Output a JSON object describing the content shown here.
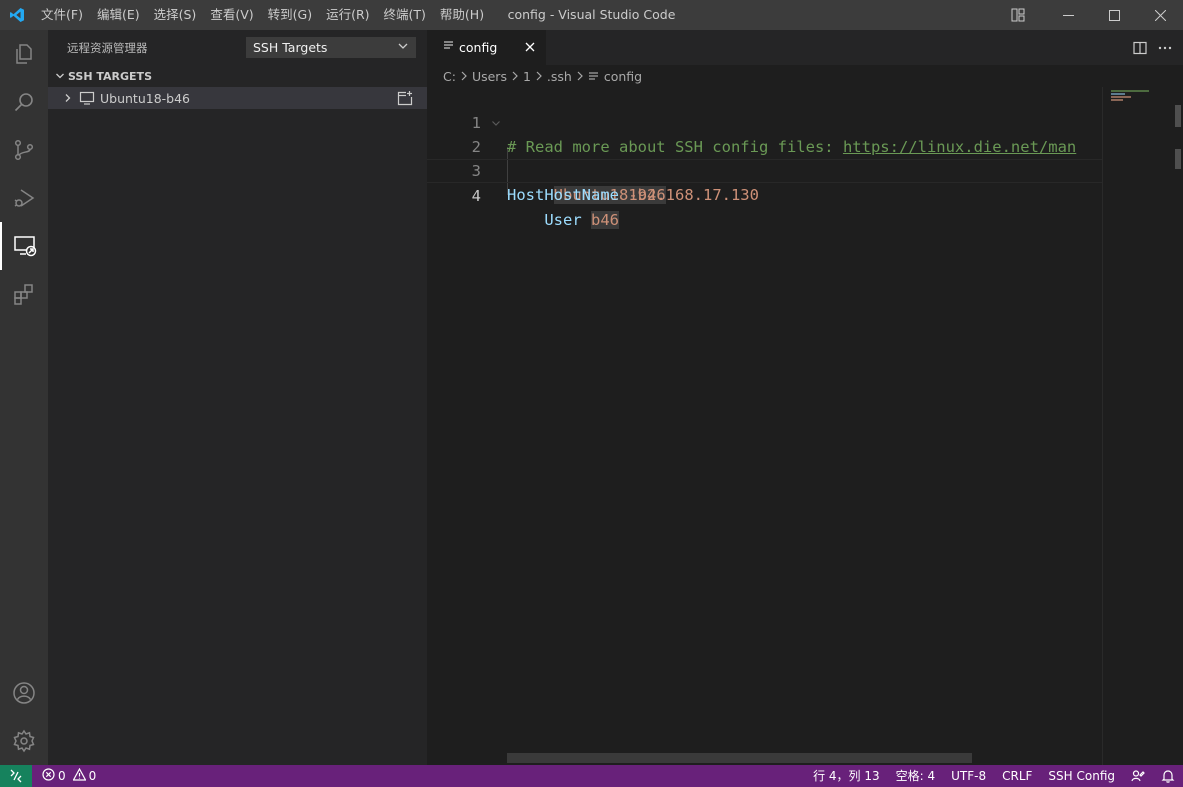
{
  "window": {
    "title": "config - Visual Studio Code",
    "menu": [
      "文件(F)",
      "编辑(E)",
      "选择(S)",
      "查看(V)",
      "转到(G)",
      "运行(R)",
      "终端(T)",
      "帮助(H)"
    ]
  },
  "activity_bar": [
    "explorer-icon",
    "search-icon",
    "source-control-icon",
    "run-debug-icon",
    "remote-explorer-icon",
    "extensions-icon",
    "account-icon",
    "settings-gear-icon"
  ],
  "sidebar": {
    "title": "远程资源管理器",
    "dropdown_value": "SSH Targets",
    "section_title": "SSH TARGETS",
    "targets": [
      {
        "label": "Ubuntu18-b46"
      }
    ]
  },
  "editor": {
    "tab_label": "config",
    "breadcrumb": [
      "C:",
      "Users",
      "1",
      ".ssh",
      "config"
    ],
    "line_numbers": [
      "1",
      "2",
      "3",
      "4"
    ],
    "lines": {
      "l1_comment": "# Read more about SSH config files: ",
      "l1_link": "https://linux.die.net/man",
      "l2_key": "Host",
      "l2_value": "Ubuntu18-b46",
      "l3_key": "HostName",
      "l3_value": "192.168.17.130",
      "l4_key": "User",
      "l4_value": "b46"
    }
  },
  "statusbar": {
    "errors": "0",
    "warnings": "0",
    "cursor": "行 4，列 13",
    "indent": "空格: 4",
    "encoding": "UTF-8",
    "eol": "CRLF",
    "language": "SSH Config"
  },
  "colors": {
    "statusbar": "#68217a",
    "remote_indicator": "#16825d",
    "comment": "#6a9955",
    "keyword": "#9cdcfe",
    "value": "#ce9178"
  }
}
